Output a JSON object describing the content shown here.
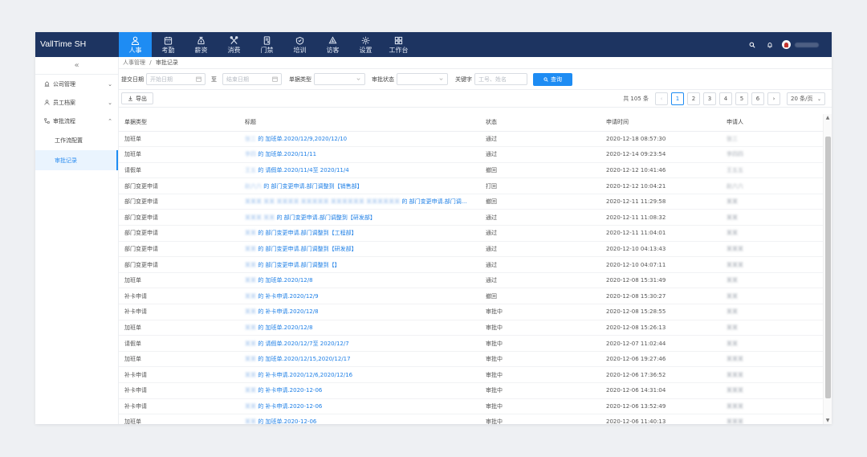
{
  "app": {
    "title": "VallTime SH"
  },
  "nav": [
    {
      "label": "人事",
      "icon": "person-icon",
      "active": true
    },
    {
      "label": "考勤",
      "icon": "calendar-icon"
    },
    {
      "label": "薪资",
      "icon": "money-bag-icon"
    },
    {
      "label": "消费",
      "icon": "utensils-icon"
    },
    {
      "label": "门禁",
      "icon": "door-icon"
    },
    {
      "label": "培训",
      "icon": "training-icon"
    },
    {
      "label": "访客",
      "icon": "visitor-icon"
    },
    {
      "label": "设置",
      "icon": "gear-icon"
    },
    {
      "label": "工作台",
      "icon": "grid-icon"
    }
  ],
  "header": {
    "username": "管理员"
  },
  "sidebar": {
    "collapse_glyph": "«",
    "groups": [
      {
        "label": "公司管理",
        "icon": "company-icon",
        "chevron": "⌄"
      },
      {
        "label": "员工档案",
        "icon": "employee-icon",
        "chevron": "⌄"
      },
      {
        "label": "审批流程",
        "icon": "workflow-icon",
        "chevron": "⌃"
      }
    ],
    "sub_items": [
      {
        "label": "工作流配置",
        "active": false
      },
      {
        "label": "审批记录",
        "active": true
      }
    ]
  },
  "breadcrumb": {
    "root": "人事管理",
    "sep": "/",
    "current": "审批记录"
  },
  "filters": {
    "submit_date_label": "提交日期",
    "start_placeholder": "开始日期",
    "to_label": "至",
    "end_placeholder": "结束日期",
    "doc_type_label": "单据类型",
    "status_label": "审批状态",
    "keyword_label": "关键字",
    "keyword_placeholder": "工号、姓名",
    "search_label": "查询"
  },
  "toolbar": {
    "export_label": "导出",
    "total": "共 105 条",
    "pages": [
      "1",
      "2",
      "3",
      "4",
      "5",
      "6"
    ],
    "current_page": "1",
    "page_size": "20 条/页"
  },
  "table": {
    "columns": [
      "单据类型",
      "标题",
      "状态",
      "申请时间",
      "申请人"
    ],
    "rows": [
      {
        "type": "加班单",
        "title_name": "张三",
        "title_text": " 的 加班单.2020/12/9,2020/12/10",
        "status": "通过",
        "time": "2020-12-18 08:57:30",
        "applicant": "张三"
      },
      {
        "type": "加班单",
        "title_name": "李四",
        "title_text": " 的 加班单.2020/11/11",
        "status": "通过",
        "time": "2020-12-14 09:23:54",
        "applicant": "李四四"
      },
      {
        "type": "请假单",
        "title_name": "王五",
        "title_text": " 的 请假单.2020/11/4至 2020/11/4",
        "status": "撤回",
        "time": "2020-12-12 10:41:46",
        "applicant": "王五五"
      },
      {
        "type": "部门变更申请",
        "title_name": "赵六六",
        "title_text": " 的 部门变更申请.部门调整到【销售部】",
        "status": "打回",
        "time": "2020-12-12 10:04:21",
        "applicant": "赵六六"
      },
      {
        "type": "部门变更申请",
        "title_name": "某某某 某某 某某某某 某某某某某 某某某某某某 某某某某某某",
        "title_text": " 的 部门变更申请.部门调...",
        "status": "撤回",
        "time": "2020-12-11 11:29:58",
        "applicant": "某某"
      },
      {
        "type": "部门变更申请",
        "title_name": "某某某 某某",
        "title_text": " 的 部门变更申请.部门调整到【研发部】",
        "status": "通过",
        "time": "2020-12-11 11:08:32",
        "applicant": "某某"
      },
      {
        "type": "部门变更申请",
        "title_name": "某某",
        "title_text": " 的 部门变更申请.部门调整到【工程部】",
        "status": "通过",
        "time": "2020-12-11 11:04:01",
        "applicant": "某某"
      },
      {
        "type": "部门变更申请",
        "title_name": "某某",
        "title_text": " 的 部门变更申请.部门调整到【研发部】",
        "status": "通过",
        "time": "2020-12-10 04:13:43",
        "applicant": "某某某"
      },
      {
        "type": "部门变更申请",
        "title_name": "某某",
        "title_text": " 的 部门变更申请.部门调整到【】",
        "status": "通过",
        "time": "2020-12-10 04:07:11",
        "applicant": "某某某"
      },
      {
        "type": "加班单",
        "title_name": "某某",
        "title_text": " 的 加班单.2020/12/8",
        "status": "通过",
        "time": "2020-12-08 15:31:49",
        "applicant": "某某"
      },
      {
        "type": "补卡申请",
        "title_name": "某某",
        "title_text": " 的 补卡申请.2020/12/9",
        "status": "撤回",
        "time": "2020-12-08 15:30:27",
        "applicant": "某某"
      },
      {
        "type": "补卡申请",
        "title_name": "某某",
        "title_text": " 的 补卡申请.2020/12/8",
        "status": "审批中",
        "time": "2020-12-08 15:28:55",
        "applicant": "某某"
      },
      {
        "type": "加班单",
        "title_name": "某某",
        "title_text": " 的 加班单.2020/12/8",
        "status": "审批中",
        "time": "2020-12-08 15:26:13",
        "applicant": "某某"
      },
      {
        "type": "请假单",
        "title_name": "某某",
        "title_text": " 的 请假单.2020/12/7至 2020/12/7",
        "status": "审批中",
        "time": "2020-12-07 11:02:44",
        "applicant": "某某"
      },
      {
        "type": "加班单",
        "title_name": "某某",
        "title_text": " 的 加班单.2020/12/15,2020/12/17",
        "status": "审批中",
        "time": "2020-12-06 19:27:46",
        "applicant": "某某某"
      },
      {
        "type": "补卡申请",
        "title_name": "某某",
        "title_text": " 的 补卡申请.2020/12/6,2020/12/16",
        "status": "审批中",
        "time": "2020-12-06 17:36:52",
        "applicant": "某某某"
      },
      {
        "type": "补卡申请",
        "title_name": "某某",
        "title_text": " 的 补卡申请.2020-12-06",
        "status": "审批中",
        "time": "2020-12-06 14:31:04",
        "applicant": "某某某"
      },
      {
        "type": "补卡申请",
        "title_name": "某某",
        "title_text": " 的 补卡申请.2020-12-06",
        "status": "审批中",
        "time": "2020-12-06 13:52:49",
        "applicant": "某某某"
      },
      {
        "type": "加班单",
        "title_name": "某某",
        "title_text": " 的 加班单.2020-12-06",
        "status": "审批中",
        "time": "2020-12-06 11:40:13",
        "applicant": "某某某"
      }
    ]
  },
  "colors": {
    "nav_bg": "#1d3461",
    "accent": "#1e8cf3",
    "link": "#1e7fe6"
  }
}
